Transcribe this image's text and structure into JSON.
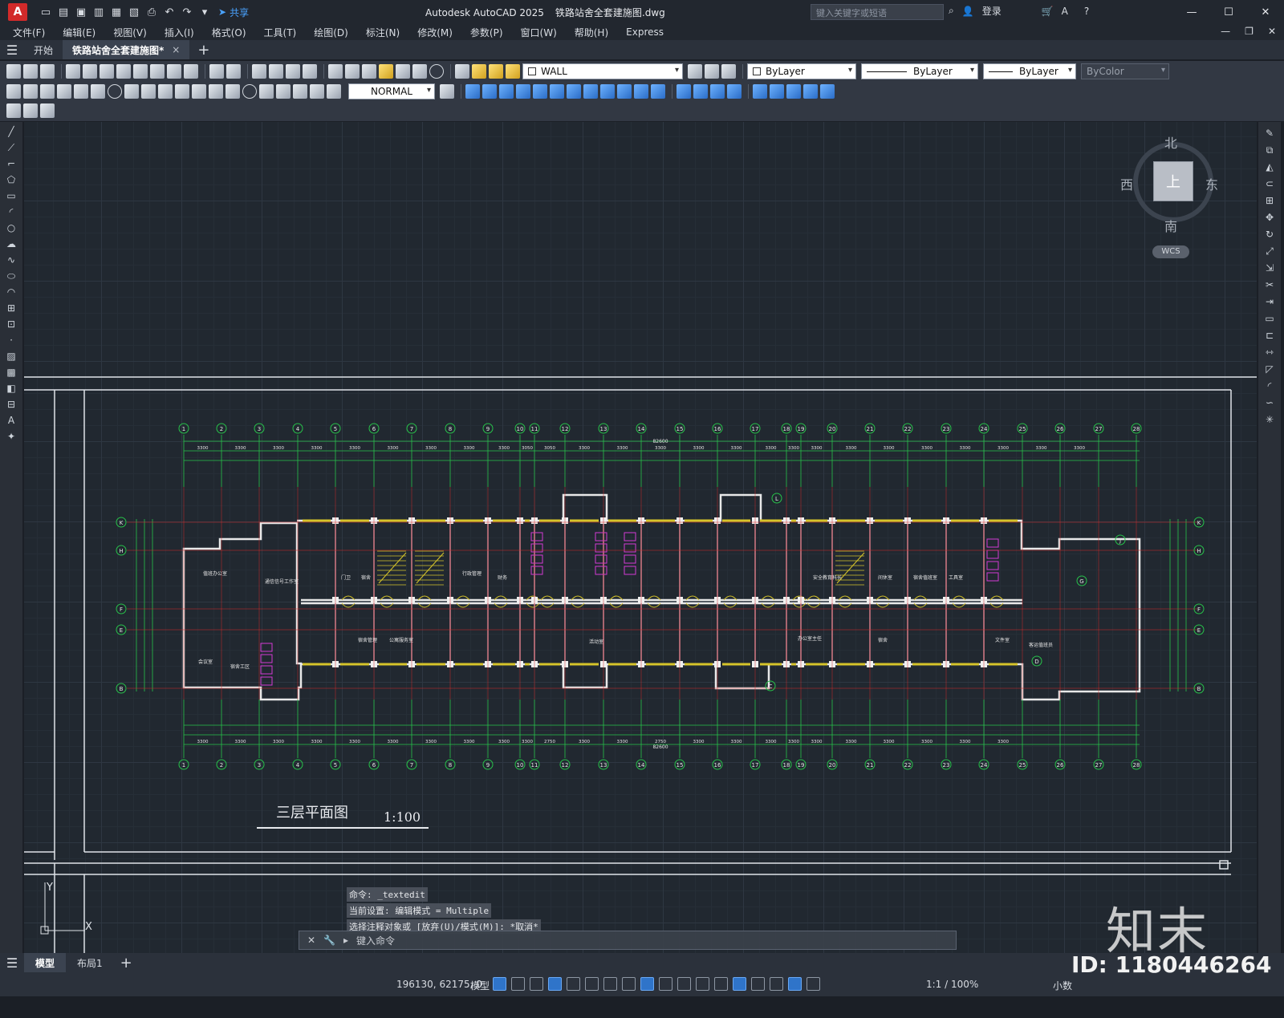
{
  "titlebar": {
    "app_letter": "A",
    "share_label": "共享",
    "app_name": "Autodesk AutoCAD 2025",
    "filename": "铁路站舍全套建施图.dwg",
    "search_placeholder": "键入关键字或短语",
    "login_label": "登录",
    "help_label": "?"
  },
  "menu": [
    "文件(F)",
    "编辑(E)",
    "视图(V)",
    "插入(I)",
    "格式(O)",
    "工具(T)",
    "绘图(D)",
    "标注(N)",
    "修改(M)",
    "参数(P)",
    "窗口(W)",
    "帮助(H)",
    "Express"
  ],
  "tabs": {
    "start": "开始",
    "document": "铁路站舍全套建施图*",
    "close": "×",
    "add": "+"
  },
  "toolbar": {
    "layer": "WALL",
    "color": "ByLayer",
    "linetype": "ByLayer",
    "lineweight": "ByLayer",
    "plotstyle": "ByColor",
    "dimstyle": "NORMAL"
  },
  "viewcube": {
    "north": "北",
    "south": "南",
    "west": "西",
    "east": "东",
    "face": "上",
    "wcs": "WCS"
  },
  "drawing": {
    "title": "三层平面图",
    "scale": "1:100",
    "total_dim": "82600",
    "axes_numbers": [
      "1",
      "2",
      "3",
      "4",
      "5",
      "6",
      "7",
      "8",
      "9",
      "10",
      "11",
      "12",
      "13",
      "14",
      "15",
      "16",
      "17",
      "18",
      "19",
      "20",
      "21",
      "22",
      "23",
      "24",
      "25",
      "26",
      "27",
      "28"
    ],
    "axes_letters": [
      "K",
      "H",
      "F",
      "E",
      "B"
    ],
    "side_letters": [
      "L",
      "J",
      "G",
      "D",
      "C"
    ],
    "top_segments": [
      "3300",
      "3300",
      "3300",
      "3300",
      "3300",
      "3300",
      "3300",
      "3300",
      "3300",
      "3050",
      "3050",
      "3300",
      "3300",
      "3300",
      "3300",
      "3300",
      "3300",
      "3300",
      "3300",
      "3300",
      "3300",
      "3300",
      "3300",
      "3300",
      "3300",
      "3300"
    ],
    "bottom_segments": [
      "3300",
      "3300",
      "3300",
      "3300",
      "3300",
      "3300",
      "3300",
      "3300",
      "3300",
      "3300",
      "2750",
      "3300",
      "3300",
      "2750",
      "3300",
      "3300",
      "3300",
      "3300",
      "3300",
      "3300",
      "3300",
      "3300",
      "3300",
      "3300"
    ],
    "rooms": [
      "值班办公室",
      "会议室",
      "通信信号工作室",
      "门卫",
      "宿舍",
      "行政管理",
      "财务",
      "安全教育科长",
      "间休室",
      "宿舍值班室",
      "工具室",
      "宿舍工区",
      "宿舍管理",
      "公寓服务室",
      "办公室主任",
      "宿舍",
      "活动室",
      "文件室",
      "客运值班员"
    ]
  },
  "command": {
    "history": [
      "命令: _textedit",
      "当前设置: 编辑模式 = Multiple",
      "选择注释对象或 [放弃(U)/模式(M)]: *取消*"
    ],
    "prompt_placeholder": "键入命令"
  },
  "layouts": [
    "模型",
    "布局1"
  ],
  "statusbar": {
    "coords": "196130, 62175, 0",
    "model": "模型",
    "scale": "1:1 / 100%",
    "units": "小数"
  },
  "watermark": {
    "logo": "知末",
    "id": "ID: 1180446264"
  }
}
